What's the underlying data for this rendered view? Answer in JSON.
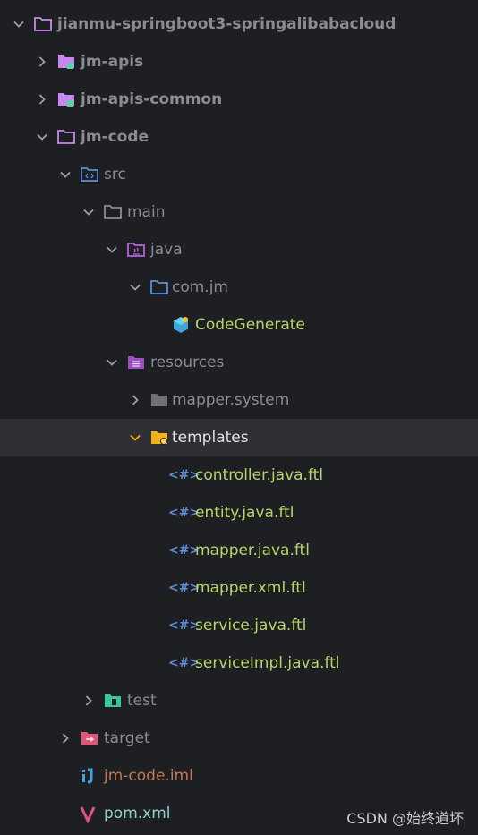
{
  "tree": {
    "root": "jianmu-springboot3-springalibabacloud",
    "jm_apis": "jm-apis",
    "jm_apis_common": "jm-apis-common",
    "jm_code": "jm-code",
    "src": "src",
    "main": "main",
    "java": "java",
    "com_jm": "com.jm",
    "code_generate": "CodeGenerate",
    "resources": "resources",
    "mapper_system": "mapper.system",
    "templates": "templates",
    "ftl_prefix": "<#>",
    "templates_files": [
      "controller.java.ftl",
      "entity.java.ftl",
      "mapper.java.ftl",
      "mapper.xml.ftl",
      "service.java.ftl",
      "serviceImpl.java.ftl"
    ],
    "test": "test",
    "target": "target",
    "iml": "jm-code.iml",
    "pom": "pom.xml"
  },
  "watermark": "CSDN @始终道坏",
  "colors": {
    "background": "#1e1f22",
    "selection": "#2f3035",
    "module_icon": "#c987f2",
    "folder_outline": "#8a8c91",
    "java_root": "#b366d6",
    "package": "#5b8ed8",
    "templates_folder": "#f3b01a",
    "test_folder": "#36c79b",
    "target_folder": "#e0557a",
    "ftl_marker": "#5b8ed8"
  }
}
